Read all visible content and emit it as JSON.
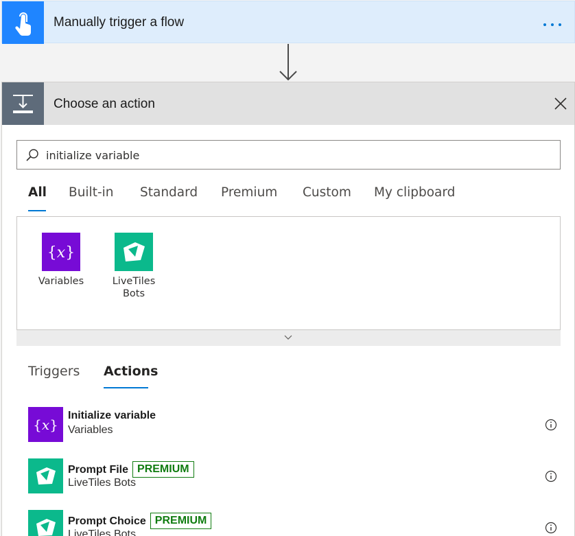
{
  "trigger": {
    "title": "Manually trigger a flow",
    "icon": "hand-touch-icon",
    "more_icon": "more-dots-icon"
  },
  "action_panel": {
    "title": "Choose an action",
    "icon": "action-icon",
    "close_icon": "close-icon",
    "search": {
      "value": "initialize variable",
      "icon": "search-icon"
    },
    "tabs": [
      {
        "label": "All",
        "active": true
      },
      {
        "label": "Built-in"
      },
      {
        "label": "Standard"
      },
      {
        "label": "Premium"
      },
      {
        "label": "Custom"
      },
      {
        "label": "My clipboard"
      }
    ],
    "connectors": [
      {
        "label": "Variables",
        "color": "#770bd6"
      },
      {
        "label": "LiveTiles Bots",
        "color": "#0bb98c"
      }
    ],
    "sub_tabs": [
      {
        "label": "Triggers"
      },
      {
        "label": "Actions",
        "active": true
      }
    ],
    "results": [
      {
        "name": "Initialize variable",
        "connector": "Variables",
        "premium": false
      },
      {
        "name": "Prompt File",
        "connector": "LiveTiles Bots",
        "premium": true,
        "badge": "PREMIUM"
      },
      {
        "name": "Prompt Choice",
        "connector": "LiveTiles Bots",
        "premium": true,
        "badge": "PREMIUM"
      }
    ]
  },
  "colors": {
    "accent": "#0078d4",
    "trigger_bg": "#deedfc",
    "premium": "#107c10"
  }
}
